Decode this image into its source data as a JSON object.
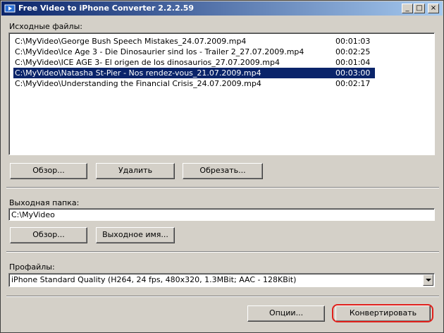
{
  "window": {
    "title": "Free Video to iPhone Converter 2.2.2.59"
  },
  "source": {
    "label": "Исходные файлы:",
    "files": [
      {
        "name": "C:\\MyVideo\\George Bush Speech Mistakes_24.07.2009.mp4",
        "duration": "00:01:03"
      },
      {
        "name": "C:\\MyVideo\\Ice Age 3 - Die Dinosaurier sind los - Trailer 2_27.07.2009.mp4",
        "duration": "00:02:25"
      },
      {
        "name": "C:\\MyVideo\\ICE AGE 3- El origen de los dinosaurios_27.07.2009.mp4",
        "duration": "00:01:04"
      },
      {
        "name": "C:\\MyVideo\\Natasha St-Pier - Nos rendez-vous_21.07.2009.mp4",
        "duration": "00:03:00"
      },
      {
        "name": "C:\\MyVideo\\Understanding the Financial Crisis_24.07.2009.mp4",
        "duration": "00:02:17"
      }
    ],
    "selected_index": 3,
    "browse_label": "Обзор...",
    "delete_label": "Удалить",
    "trim_label": "Обрезать..."
  },
  "output": {
    "label": "Выходная папка:",
    "path": "C:\\MyVideo",
    "browse_label": "Обзор...",
    "name_label": "Выходное имя..."
  },
  "profiles": {
    "label": "Профайлы:",
    "selected": "iPhone Standard Quality (H264, 24 fps, 480x320, 1.3MBit; AAC - 128KBit)"
  },
  "footer": {
    "options_label": "Опции...",
    "convert_label": "Конвертировать"
  },
  "colors": {
    "title_start": "#0a246a",
    "title_end": "#a6caf0",
    "selection": "#0a246a",
    "highlight": "#e0201b"
  }
}
